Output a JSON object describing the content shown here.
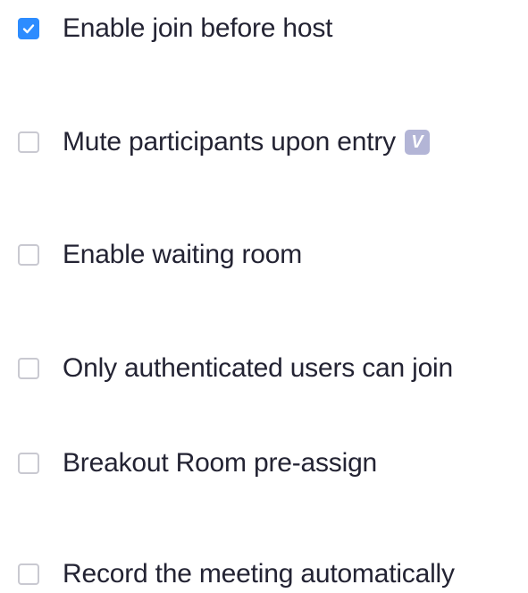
{
  "options": [
    {
      "label": "Enable join before host",
      "checked": true
    },
    {
      "label": "Mute participants upon entry",
      "checked": false,
      "badge": "V"
    },
    {
      "label": "Enable waiting room",
      "checked": false
    },
    {
      "label": "Only authenticated users can join",
      "checked": false
    },
    {
      "label": "Breakout Room pre-assign",
      "checked": false
    },
    {
      "label": "Record the meeting automatically",
      "checked": false
    }
  ],
  "colors": {
    "accent": "#2d8cff",
    "checkbox_border": "#c9c9d1",
    "text": "#232333",
    "badge_bg": "#b3b5d6"
  },
  "icons": {
    "check": "checkmark-icon",
    "badge": "video-badge-icon"
  }
}
